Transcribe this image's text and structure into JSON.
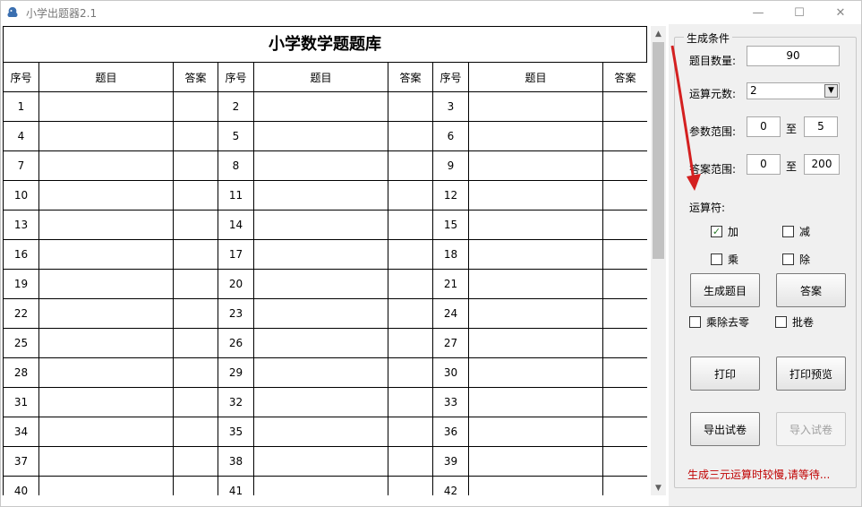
{
  "window": {
    "title": "小学出题器2.1",
    "controls": {
      "minimize": "—",
      "maximize": "☐",
      "close": "✕"
    }
  },
  "sheet": {
    "title": "小学数学题题库",
    "headers": [
      "序号",
      "题目",
      "答案",
      "序号",
      "题目",
      "答案",
      "序号",
      "题目",
      "答案"
    ],
    "rows": [
      [
        1,
        2,
        3
      ],
      [
        4,
        5,
        6
      ],
      [
        7,
        8,
        9
      ],
      [
        10,
        11,
        12
      ],
      [
        13,
        14,
        15
      ],
      [
        16,
        17,
        18
      ],
      [
        19,
        20,
        21
      ],
      [
        22,
        23,
        24
      ],
      [
        25,
        26,
        27
      ],
      [
        28,
        29,
        30
      ],
      [
        31,
        32,
        33
      ],
      [
        34,
        35,
        36
      ],
      [
        37,
        38,
        39
      ],
      [
        40,
        41,
        42
      ]
    ]
  },
  "panel": {
    "group_title": "生成条件",
    "count_label": "题目数量:",
    "count_value": "90",
    "operands_label": "运算元数:",
    "operands_value": "2",
    "param_range_label": "参数范围:",
    "param_min": "0",
    "param_to": "至",
    "param_max": "5",
    "answer_range_label": "答案范围:",
    "answer_min": "0",
    "answer_to": "至",
    "answer_max": "200",
    "operators_label": "运算符:",
    "ops": {
      "add": "加",
      "sub": "减",
      "mul": "乘",
      "div": "除"
    },
    "ops_checked": {
      "add": true,
      "sub": false,
      "mul": false,
      "div": false
    },
    "generate_button": "生成题目",
    "answer_button": "答案",
    "no_zero_label": "乘除去零",
    "grade_label": "批卷",
    "print_button": "打印",
    "preview_button": "打印预览",
    "export_button": "导出试卷",
    "import_button": "导入试卷",
    "status_text": "生成三元运算时较慢,请等待..."
  },
  "colors": {
    "status": "#c00000",
    "annotation_arrow": "#d42020",
    "check": "#2a7a2a"
  }
}
